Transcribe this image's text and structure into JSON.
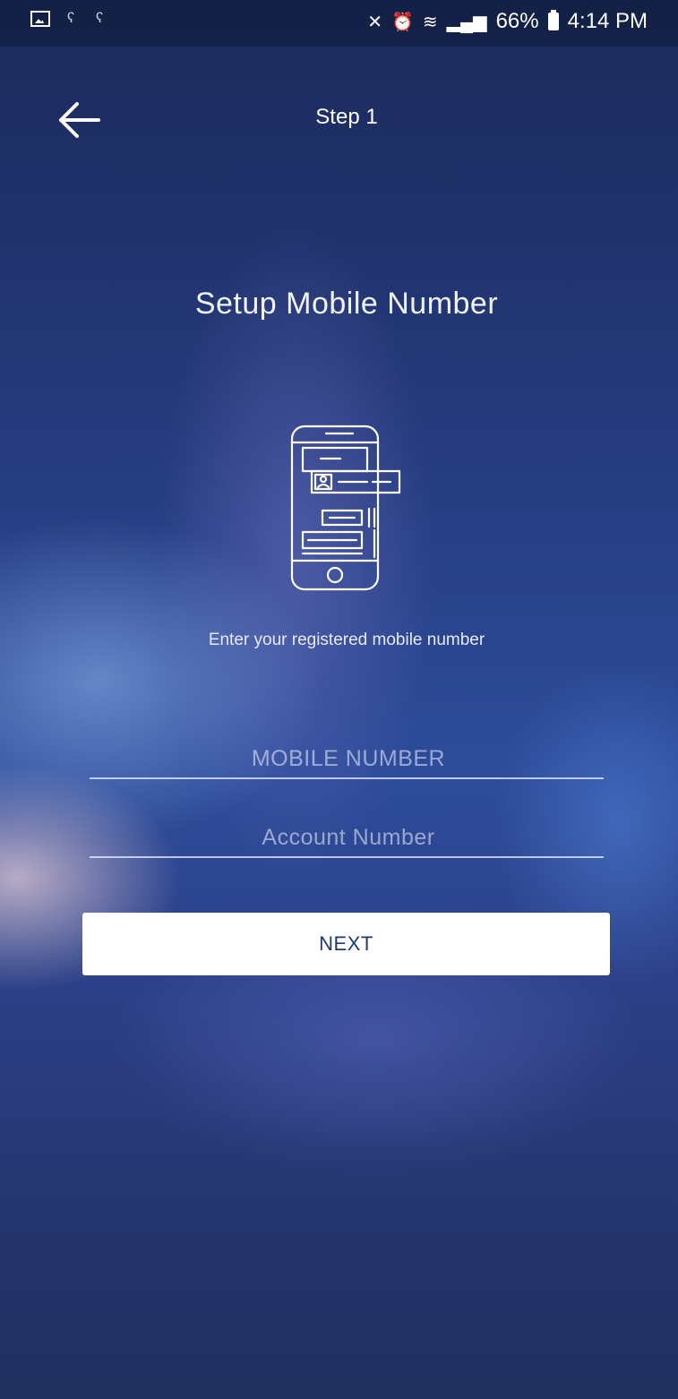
{
  "status_bar": {
    "left_icons": [
      "image-icon",
      "key-icon",
      "key-icon"
    ],
    "right_icons": [
      "mute-icon",
      "alarm-icon",
      "wifi-icon",
      "signal-icon"
    ],
    "battery_percent": "66%",
    "time": "4:14 PM"
  },
  "header": {
    "back_icon": "arrow-left-icon",
    "step_title": "Step 1"
  },
  "main": {
    "title": "Setup Mobile Number",
    "illustration_icon": "phone-form-icon",
    "instruction": "Enter your registered mobile number",
    "mobile_field": {
      "placeholder": "MOBILE NUMBER",
      "value": ""
    },
    "account_field": {
      "placeholder": "Account Number",
      "value": ""
    },
    "next_label": "NEXT"
  },
  "colors": {
    "button_text": "#1f3a73",
    "button_bg": "#ffffff",
    "background": "#253a7c"
  }
}
